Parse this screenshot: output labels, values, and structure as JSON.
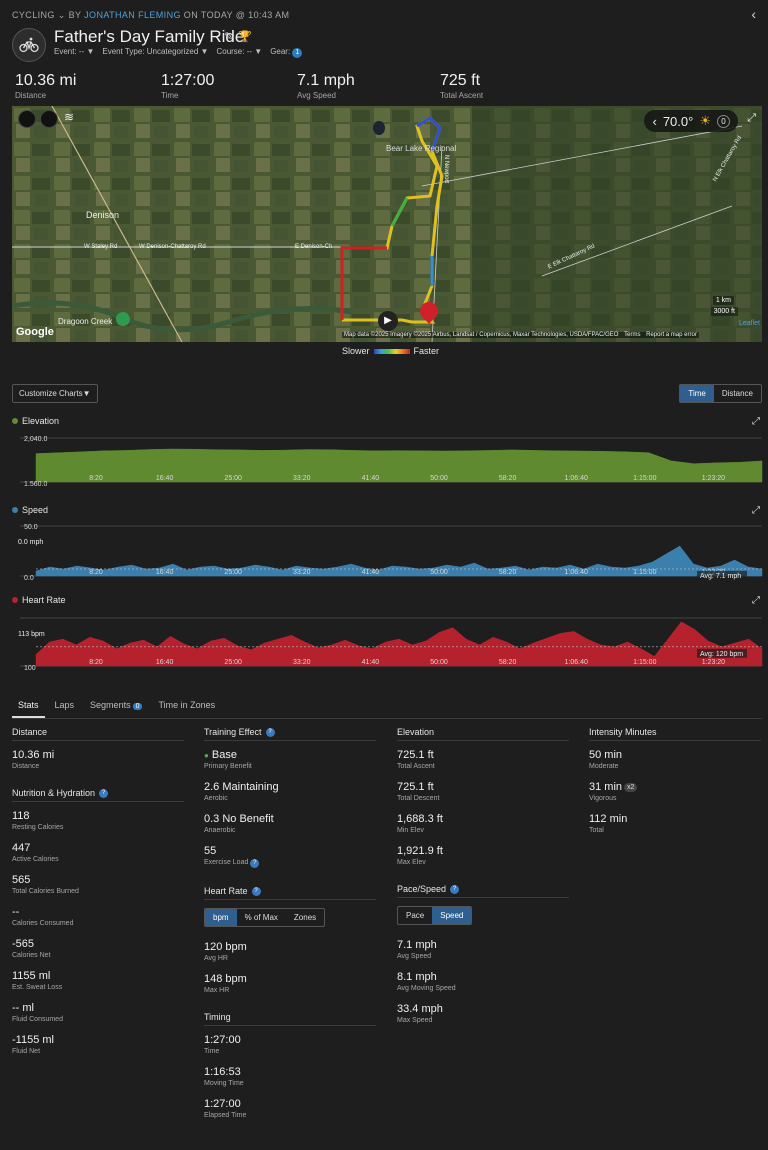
{
  "header": {
    "activity_type": "CYCLING",
    "by": "BY",
    "author": "JONATHAN FLEMING",
    "when": "ON TODAY @ 10:43 AM",
    "title": "Father's Day Family Ride",
    "event": "Event: --",
    "event_type": "Event Type: Uncategorized",
    "course": "Course: --",
    "gear": "Gear:",
    "gear_count": "1"
  },
  "top_stats": [
    {
      "value": "10.36 mi",
      "label": "Distance"
    },
    {
      "value": "1:27:00",
      "label": "Time"
    },
    {
      "value": "7.1 mph",
      "label": "Avg Speed"
    },
    {
      "value": "725 ft",
      "label": "Total Ascent"
    }
  ],
  "map": {
    "temperature": "70.0°",
    "weather_count": "0",
    "labels": [
      "Denison",
      "Bear Lake Regional",
      "W Staley Rd",
      "W Denison-Chattaroy Rd",
      "E Denison-Ch",
      "E Elk Chattaroy Rd",
      "N Elk Chattaroy Rd",
      "Dragoon Creek",
      "N Newport"
    ],
    "scale_km": "1 km",
    "scale_ft": "3000 ft",
    "attribution": "Map data ©2025 Imagery ©2025 Airbus, Landsat / Copernicus, Maxar Technologies, USDA/FPAC/GEO",
    "terms": "Terms",
    "report": "Report a map error",
    "leaflet": "Leaflet",
    "google": "Google"
  },
  "legend": {
    "slower": "Slower",
    "faster": "Faster"
  },
  "chart_controls": {
    "customize": "Customize Charts",
    "time": "Time",
    "distance": "Distance"
  },
  "colors": {
    "elevation": "#5f8a2f",
    "speed": "#3a7fae",
    "heart_rate": "#b5222e",
    "accent": "#2f7bbf"
  },
  "chart_data": [
    {
      "type": "area",
      "title": "Elevation",
      "y_labels": [
        "2,040.0",
        "1,560.0"
      ],
      "ylim": [
        1560,
        2040
      ],
      "x_ticks": [
        "8:20",
        "16:40",
        "25:00",
        "33:20",
        "41:40",
        "50:00",
        "58:20",
        "1:06:40",
        "1:15:00",
        "1:23:20"
      ],
      "values": [
        1870,
        1880,
        1890,
        1900,
        1905,
        1915,
        1920,
        1918,
        1912,
        1910,
        1905,
        1908,
        1915,
        1912,
        1905,
        1900,
        1902,
        1900,
        1898,
        1900,
        1905,
        1910,
        1905,
        1900,
        1898,
        1895,
        1890,
        1880,
        1790,
        1760,
        1770,
        1775,
        1790
      ]
    },
    {
      "type": "area",
      "title": "Speed",
      "y_labels": [
        "50.0",
        "0.0"
      ],
      "cursor_label": "0.0 mph",
      "avg_label": "Avg: 7.1 mph",
      "avg": 7.1,
      "ylim": [
        0,
        50
      ],
      "x_ticks": [
        "8:20",
        "16:40",
        "25:00",
        "33:20",
        "41:40",
        "50:00",
        "58:20",
        "1:06:40",
        "1:15:00",
        "1:23:20"
      ],
      "values": [
        5,
        9,
        7,
        10,
        8,
        6,
        9,
        11,
        7,
        8,
        12,
        6,
        9,
        10,
        7,
        8,
        11,
        9,
        6,
        10,
        8,
        7,
        9,
        12,
        8,
        6,
        10,
        9,
        7,
        8,
        11,
        9,
        13,
        7,
        8,
        10,
        6,
        9,
        8,
        11,
        7,
        12,
        9,
        8,
        10,
        14,
        22,
        30,
        12,
        8,
        10,
        16,
        9,
        7
      ]
    },
    {
      "type": "area",
      "title": "Heart Rate",
      "y_labels": [
        "100"
      ],
      "cursor_label": "113 bpm",
      "avg_label": "Avg: 120 bpm",
      "avg": 120,
      "ylim": [
        100,
        150
      ],
      "x_ticks": [
        "8:20",
        "16:40",
        "25:00",
        "33:20",
        "41:40",
        "50:00",
        "58:20",
        "1:06:40",
        "1:15:00",
        "1:23:20"
      ],
      "values": [
        112,
        125,
        128,
        122,
        130,
        126,
        118,
        124,
        127,
        120,
        131,
        123,
        118,
        126,
        129,
        121,
        117,
        124,
        128,
        132,
        125,
        119,
        122,
        127,
        121,
        118,
        125,
        128,
        122,
        126,
        135,
        140,
        128,
        122,
        130,
        125,
        118,
        124,
        129,
        134,
        136,
        128,
        122,
        120,
        125,
        118,
        110,
        128,
        146,
        138,
        126,
        120,
        124,
        128,
        118
      ]
    }
  ],
  "stats_tabs": [
    "Stats",
    "Laps",
    "Segments",
    "Time in Zones"
  ],
  "segments_count": "0",
  "stats": {
    "distance_section": "Distance",
    "distance": {
      "value": "10.36 mi",
      "label": "Distance"
    },
    "nutrition_section": "Nutrition & Hydration",
    "nutrition": [
      {
        "value": "118",
        "label": "Resting Calories"
      },
      {
        "value": "447",
        "label": "Active Calories"
      },
      {
        "value": "565",
        "label": "Total Calories Burned"
      },
      {
        "value": "--",
        "label": "Calories Consumed"
      },
      {
        "value": "-565",
        "label": "Calories Net"
      },
      {
        "value": "1155 ml",
        "label": "Est. Sweat Loss"
      },
      {
        "value": "-- ml",
        "label": "Fluid Consumed"
      },
      {
        "value": "-1155 ml",
        "label": "Fluid Net"
      }
    ],
    "training_section": "Training Effect",
    "training": [
      {
        "value": "Base",
        "label": "Primary Benefit"
      },
      {
        "value": "2.6 Maintaining",
        "label": "Aerobic"
      },
      {
        "value": "0.3 No Benefit",
        "label": "Anaerobic"
      },
      {
        "value": "55",
        "label": "Exercise Load"
      }
    ],
    "hr_section": "Heart Rate",
    "hr_toggle": [
      "bpm",
      "% of Max",
      "Zones"
    ],
    "hr": [
      {
        "value": "120 bpm",
        "label": "Avg HR"
      },
      {
        "value": "148 bpm",
        "label": "Max HR"
      }
    ],
    "timing_section": "Timing",
    "timing": [
      {
        "value": "1:27:00",
        "label": "Time"
      },
      {
        "value": "1:16:53",
        "label": "Moving Time"
      },
      {
        "value": "1:27:00",
        "label": "Elapsed Time"
      }
    ],
    "elevation_section": "Elevation",
    "elevation": [
      {
        "value": "725.1 ft",
        "label": "Total Ascent"
      },
      {
        "value": "725.1 ft",
        "label": "Total Descent"
      },
      {
        "value": "1,688.3 ft",
        "label": "Min Elev"
      },
      {
        "value": "1,921.9 ft",
        "label": "Max Elev"
      }
    ],
    "pace_section": "Pace/Speed",
    "pace_toggle": [
      "Pace",
      "Speed"
    ],
    "pace": [
      {
        "value": "7.1 mph",
        "label": "Avg Speed"
      },
      {
        "value": "8.1 mph",
        "label": "Avg Moving Speed"
      },
      {
        "value": "33.4 mph",
        "label": "Max Speed"
      }
    ],
    "intensity_section": "Intensity Minutes",
    "intensity": [
      {
        "value": "50 min",
        "label": "Moderate"
      },
      {
        "value": "31 min",
        "label": "Vigorous",
        "badge": "x2"
      },
      {
        "value": "112 min",
        "label": "Total"
      }
    ]
  }
}
